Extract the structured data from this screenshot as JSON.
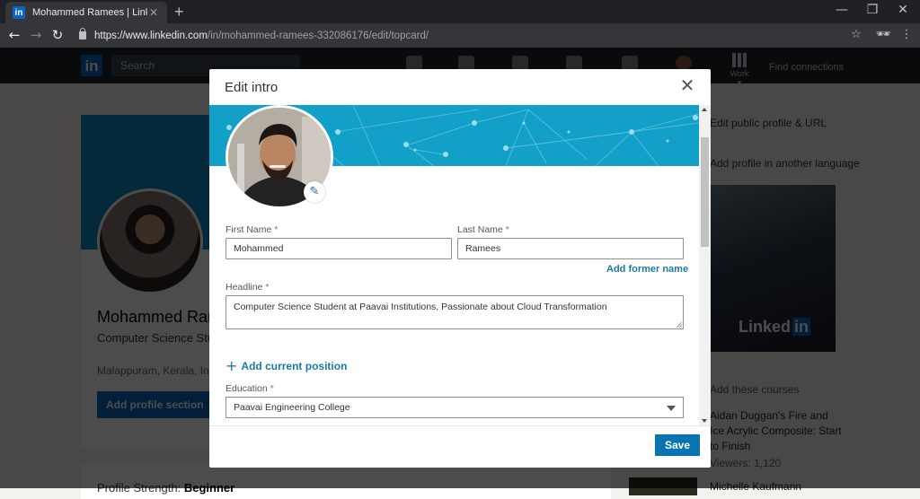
{
  "browser": {
    "tab_title": "Mohammed Ramees | LinkedIn",
    "tab_favicon": "in",
    "url_host": "https://www.linkedin.com",
    "url_path": "/in/mohammed-ramees-332086176/edit/topcard/",
    "icons": [
      "back-icon",
      "forward-icon",
      "reload-icon",
      "lock-icon",
      "star-icon",
      "incognito-icon",
      "menu-icon",
      "minimize-icon",
      "restore-icon",
      "close-icon"
    ]
  },
  "linkedin_nav": {
    "logo": "in",
    "search_placeholder": "Search",
    "work_label": "Work ▾",
    "find_connections": "Find connections"
  },
  "background_profile": {
    "name": "Mohammed Ramees",
    "headline": "Computer Science Student at Paavai Institutions, Passionate about Cloud Transformation",
    "location": "Malappuram, Kerala, India",
    "add_section_button": "Add profile section",
    "strength_label": "Profile Strength:",
    "strength_value": "Beginner"
  },
  "background_sidebar": {
    "item1": "Edit public profile & URL",
    "item2": "Add profile in another language",
    "ad_logo_a": "Linked",
    "ad_logo_b": "in",
    "courses_heading": "Add these courses",
    "course_title": "Aidan Duggan's Fire and Ice Acrylic Composite: Start to Finish",
    "course_viewers": "Viewers: 1,120",
    "course2_title": "Michelle Kaufmann"
  },
  "modal": {
    "title": "Edit intro",
    "close_icon": "close-icon",
    "first_name_label": "First Name",
    "first_name_value": "Mohammed",
    "last_name_label": "Last Name",
    "last_name_value": "Ramees",
    "required_mark": "*",
    "add_former_name": "Add former name",
    "headline_label": "Headline",
    "headline_value": "Computer Science Student at Paavai Institutions, Passionate about Cloud Transformation",
    "add_position": "Add current position",
    "education_label": "Education",
    "education_value": "Paavai Engineering College",
    "save_label": "Save",
    "edit_photo_icon": "pencil-icon"
  },
  "colors": {
    "brand": "#0a66c2",
    "save_button": "#0a73b1",
    "link": "#1b7ba6",
    "banner": "#12a0c9"
  }
}
